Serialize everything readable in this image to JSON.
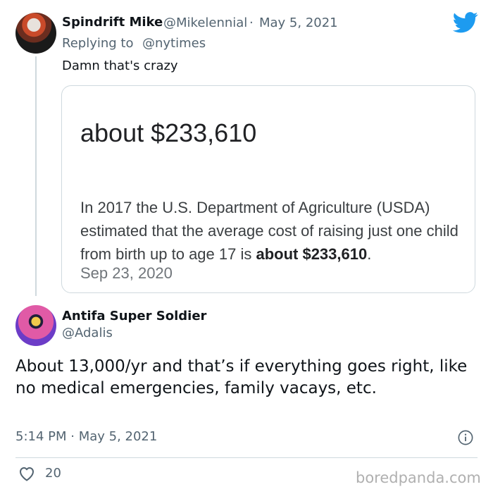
{
  "tweet1": {
    "name": "Spindrift Mike",
    "handle": "@Mikelennial",
    "separator": "·",
    "date": "May 5, 2021",
    "reply_prefix": "Replying to",
    "reply_to": "@nytimes",
    "body": "Damn that's crazy",
    "card": {
      "headline": "about $233,610",
      "text_before": "In 2017 the U.S. Department of Agriculture (USDA) estimated that the average cost of raising just one child from birth up to age 17 is ",
      "text_bold": "about $233,610",
      "text_after": ".",
      "date": "Sep 23, 2020"
    }
  },
  "tweet2": {
    "name": "Antifa Super Soldier",
    "handle": "@Adalis",
    "body": "About 13,000/yr and that’s if everything goes right, like no medical emergencies, family vacays, etc.",
    "time": "5:14 PM · May 5, 2021",
    "likes": "20"
  },
  "icons": {
    "brand": "twitter-bird-icon",
    "info": "info-icon",
    "like": "heart-icon"
  },
  "colors": {
    "twitter_blue": "#1d9bf0",
    "secondary_text": "#536471",
    "border": "#cfd9de"
  },
  "watermark": "boredpanda.com"
}
